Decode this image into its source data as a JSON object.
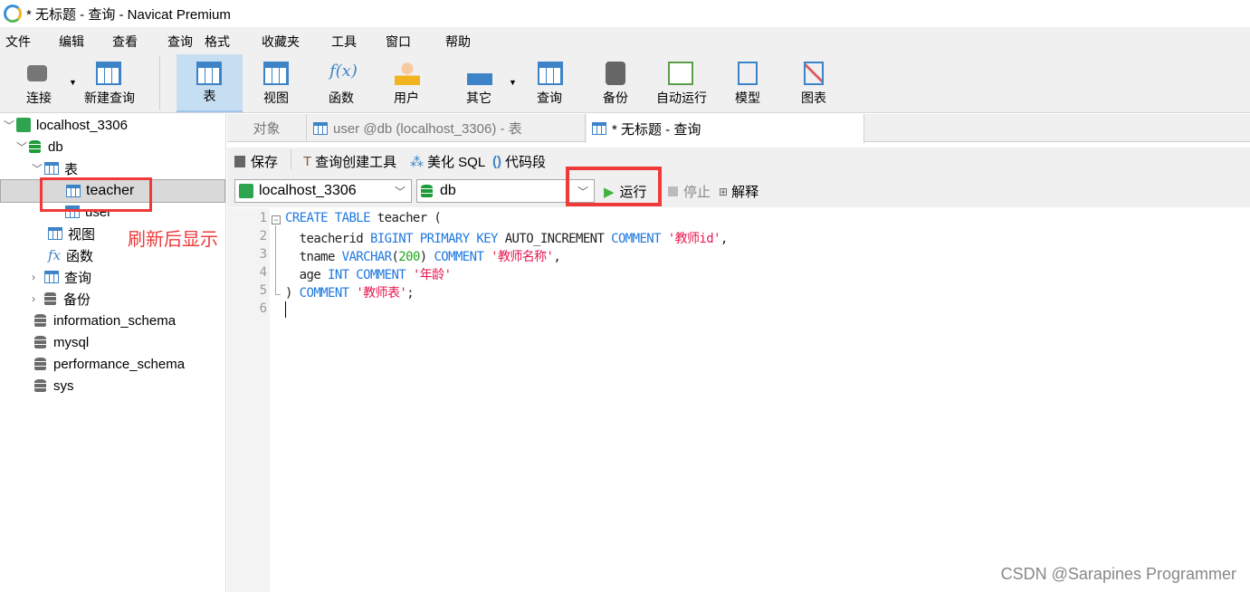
{
  "window": {
    "title": "* 无标题 - 查询 - Navicat Premium"
  },
  "menu": [
    "文件",
    "编辑",
    "查看",
    "查询",
    "格式",
    "收藏夹",
    "工具",
    "窗口",
    "帮助"
  ],
  "toolbar": [
    {
      "label": "连接",
      "icon": "plug-icon"
    },
    {
      "label": "新建查询",
      "icon": "new-query-icon"
    },
    {
      "label": "表",
      "icon": "table-icon",
      "active": true
    },
    {
      "label": "视图",
      "icon": "view-icon"
    },
    {
      "label": "函数",
      "icon": "function-icon"
    },
    {
      "label": "用户",
      "icon": "user-icon"
    },
    {
      "label": "其它",
      "icon": "tools-icon"
    },
    {
      "label": "查询",
      "icon": "query-icon"
    },
    {
      "label": "备份",
      "icon": "backup-icon"
    },
    {
      "label": "自动运行",
      "icon": "schedule-icon"
    },
    {
      "label": "模型",
      "icon": "model-icon"
    },
    {
      "label": "图表",
      "icon": "chart-icon"
    }
  ],
  "sidebar": {
    "connection": "localhost_3306",
    "db": "db",
    "tables_label": "表",
    "tables": [
      "teacher",
      "user"
    ],
    "selected": "teacher",
    "views": "视图",
    "functions": "函数",
    "queries": "查询",
    "backups": "备份",
    "other_dbs": [
      "information_schema",
      "mysql",
      "performance_schema",
      "sys"
    ]
  },
  "annotation": "刷新后显示",
  "tabs": [
    "对象",
    "user @db (localhost_3306) - 表",
    "* 无标题 - 查询"
  ],
  "query_toolbar": {
    "save": "保存",
    "builder": "查询创建工具",
    "beautify": "美化 SQL",
    "snippet": "代码段"
  },
  "query_select": {
    "connection": "localhost_3306",
    "database": "db",
    "run": "运行",
    "stop": "停止",
    "explain": "解释"
  },
  "code": [
    [
      [
        "CREATE TABLE",
        "k"
      ],
      [
        " teacher (",
        "p"
      ]
    ],
    [
      [
        "  teacherid ",
        "p"
      ],
      [
        "BIGINT PRIMARY KEY",
        "k"
      ],
      [
        " AUTO_INCREMENT ",
        "p"
      ],
      [
        "COMMENT",
        "k"
      ],
      [
        " ",
        "p"
      ],
      [
        "'教师id'",
        "s"
      ],
      [
        ",",
        "p"
      ]
    ],
    [
      [
        "  tname ",
        "p"
      ],
      [
        "VARCHAR",
        "k"
      ],
      [
        "(",
        "p"
      ],
      [
        "200",
        "n"
      ],
      [
        ") ",
        "p"
      ],
      [
        "COMMENT",
        "k"
      ],
      [
        " ",
        "p"
      ],
      [
        "'教师名称'",
        "s"
      ],
      [
        ",",
        "p"
      ]
    ],
    [
      [
        "  age ",
        "p"
      ],
      [
        "INT COMMENT",
        "k"
      ],
      [
        " ",
        "p"
      ],
      [
        "'年龄'",
        "s"
      ]
    ],
    [
      [
        ") ",
        "p"
      ],
      [
        "COMMENT",
        "k"
      ],
      [
        " ",
        "p"
      ],
      [
        "'教师表'",
        "s"
      ],
      [
        ";",
        "p"
      ]
    ],
    []
  ],
  "watermark": "CSDN @Sarapines Programmer"
}
